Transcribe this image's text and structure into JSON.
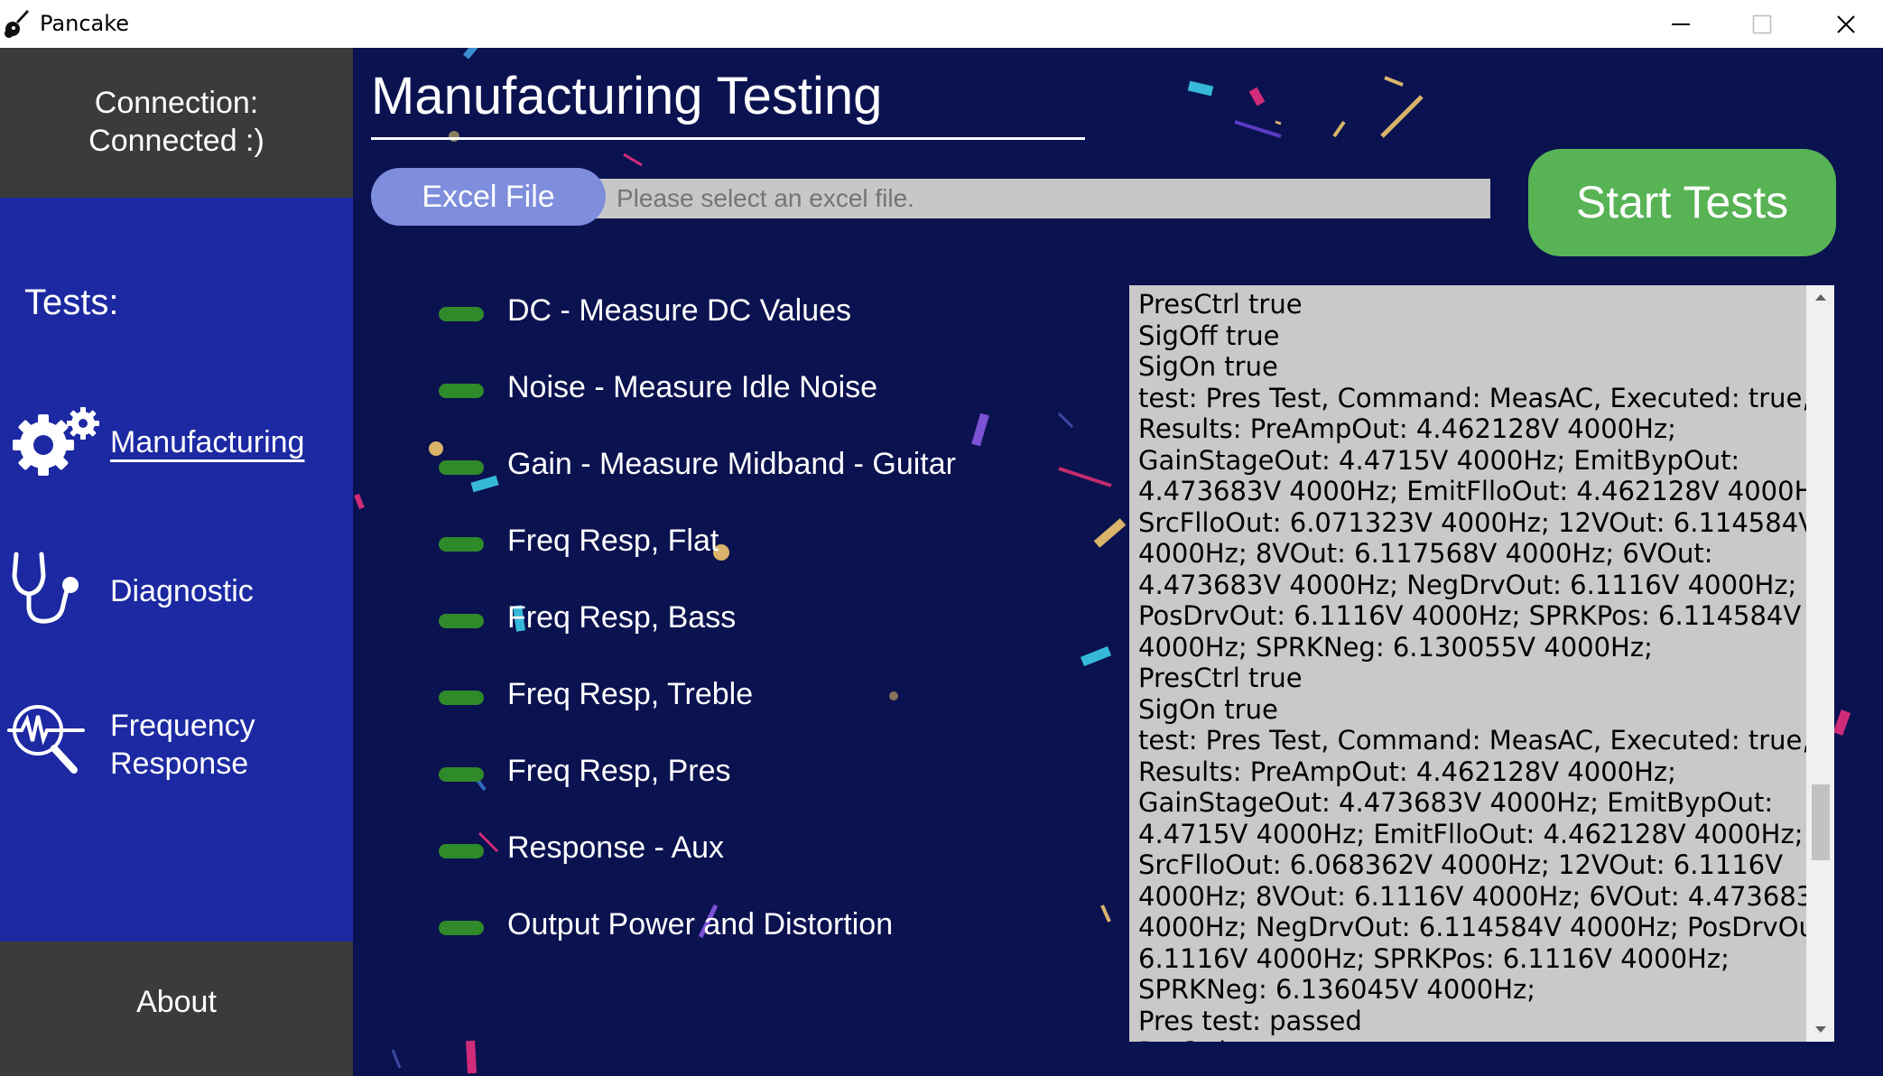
{
  "window": {
    "title": "Pancake",
    "minimize_icon": "minimize-icon",
    "maximize_icon": "maximize-icon",
    "close_icon": "close-icon"
  },
  "sidebar": {
    "connection_line1": "Connection:",
    "connection_line2": "Connected :)",
    "tests_label": "Tests:",
    "items": [
      {
        "label": "Manufacturing",
        "icon": "gears-icon",
        "active": true
      },
      {
        "label": "Diagnostic",
        "icon": "stethoscope-icon",
        "active": false
      },
      {
        "label_line1": "Frequency",
        "label_line2": "Response",
        "icon": "magnifier-waveform-icon",
        "active": false
      }
    ],
    "about": "About"
  },
  "main": {
    "title": "Manufacturing Testing",
    "excel_button": "Excel File",
    "file_placeholder": "Please select an excel file.",
    "start_button": "Start Tests",
    "tests": [
      {
        "label": "DC - Measure DC Values",
        "status_color": "#2f8a2a"
      },
      {
        "label": "Noise - Measure Idle Noise",
        "status_color": "#2f8a2a"
      },
      {
        "label": "Gain - Measure Midband - Guitar",
        "status_color": "#2f8a2a"
      },
      {
        "label": "Freq Resp, Flat",
        "status_color": "#2f8a2a"
      },
      {
        "label": "Freq Resp, Bass",
        "status_color": "#2f8a2a"
      },
      {
        "label": "Freq Resp, Treble",
        "status_color": "#2f8a2a"
      },
      {
        "label": "Freq Resp, Pres",
        "status_color": "#2f8a2a"
      },
      {
        "label": "Response - Aux",
        "status_color": "#2f8a2a"
      },
      {
        "label": "Output Power and Distortion",
        "status_color": "#2f8a2a"
      }
    ],
    "log": "PresCtrl true\nSigOff true\nSigOn true\ntest: Pres Test, Command: MeasAC, Executed: true,\nResults: PreAmpOut: 4.462128V 4000Hz;\nGainStageOut: 4.4715V 4000Hz; EmitBypOut:\n4.473683V 4000Hz; EmitFlloOut: 4.462128V 4000Hz;\nSrcFlloOut: 6.071323V 4000Hz; 12VOut: 6.114584V\n4000Hz; 8VOut: 6.117568V 4000Hz; 6VOut:\n4.473683V 4000Hz; NegDrvOut: 6.1116V 4000Hz;\nPosDrvOut: 6.1116V 4000Hz; SPRKPos: 6.114584V\n4000Hz; SPRKNeg: 6.130055V 4000Hz;\nPresCtrl true\nSigOn true\ntest: Pres Test, Command: MeasAC, Executed: true,\nResults: PreAmpOut: 4.462128V 4000Hz;\nGainStageOut: 4.473683V 4000Hz; EmitBypOut:\n4.4715V 4000Hz; EmitFlloOut: 4.462128V 4000Hz;\nSrcFlloOut: 6.068362V 4000Hz; 12VOut: 6.1116V\n4000Hz; 8VOut: 6.1116V 4000Hz; 6VOut: 4.473683V\n4000Hz; NegDrvOut: 6.114584V 4000Hz; PosDrvOut:\n6.1116V 4000Hz; SPRKPos: 6.1116V 4000Hz;\nSPRKNeg: 6.136045V 4000Hz;\nPres test: passed\nPotCtrl true"
  },
  "colors": {
    "sidebar_bg": "#1c29a2",
    "sidebar_dark": "#3b3b3b",
    "main_bg": "#0b1250",
    "accent_button": "#7e8ddc",
    "start_button": "#57b354",
    "status_ok": "#2f8a2a"
  }
}
